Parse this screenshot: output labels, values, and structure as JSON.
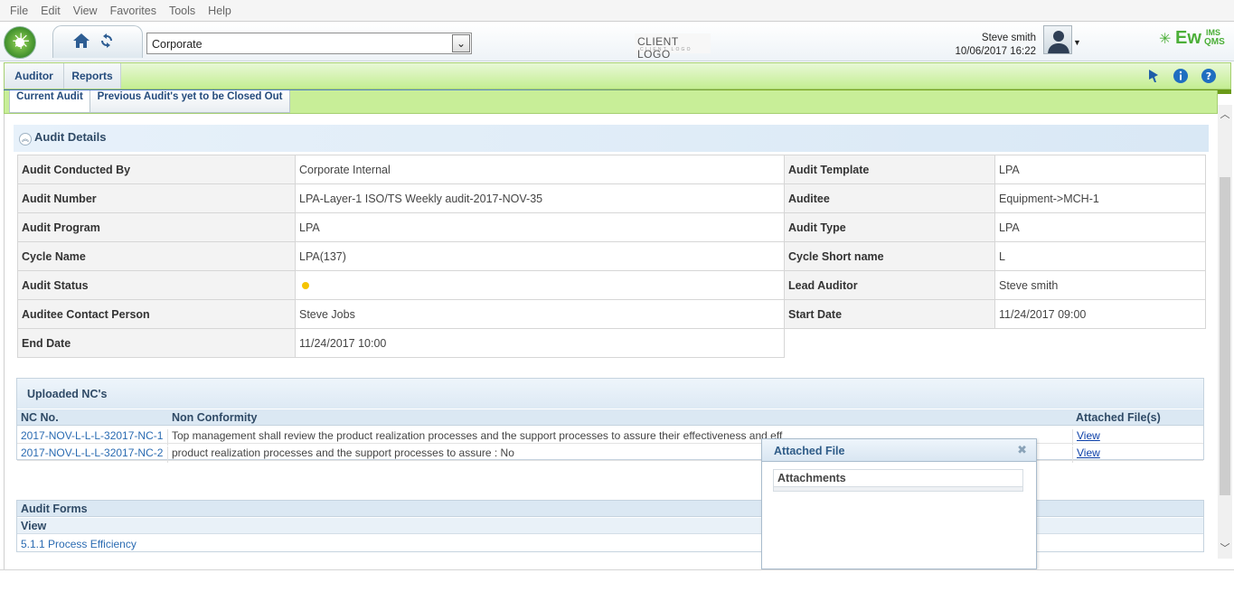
{
  "menu": [
    "File",
    "Edit",
    "View",
    "Favorites",
    "Tools",
    "Help"
  ],
  "header": {
    "organization_selected": "Corporate",
    "client_logo_text": "CLIENT LOGO",
    "client_logo_sub": "CLIENT LOGO",
    "user_name": "Steve smith",
    "user_datetime": "10/06/2017 16:22",
    "brand_ew": "Ew",
    "brand_ims": "IMS",
    "brand_qms": "QMS"
  },
  "toolbar": {
    "tabs": [
      "Auditor",
      "Reports"
    ]
  },
  "subtabs": [
    "Current Audit",
    "Previous Audit's yet to be Closed Out"
  ],
  "audit_details": {
    "title": "Audit Details",
    "rows": [
      {
        "l1": "Audit Conducted By",
        "v1": "Corporate Internal",
        "l2": "Audit Template",
        "v2": "LPA"
      },
      {
        "l1": "Audit Number",
        "v1": "LPA-Layer-1 ISO/TS Weekly audit-2017-NOV-35",
        "l2": "Auditee",
        "v2": "Equipment->MCH-1"
      },
      {
        "l1": "Audit Program",
        "v1": "LPA",
        "l2": "Audit Type",
        "v2": "LPA"
      },
      {
        "l1": "Cycle Name",
        "v1": "LPA(137)",
        "l2": "Cycle Short name",
        "v2": "L"
      },
      {
        "l1": "Audit Status",
        "v1": "",
        "l2": "Lead Auditor",
        "v2": "Steve smith"
      },
      {
        "l1": "Auditee Contact Person",
        "v1": "Steve Jobs",
        "l2": "Start Date",
        "v2": "11/24/2017 09:00"
      },
      {
        "l1": "End Date",
        "v1": "11/24/2017 10:00",
        "l2": "",
        "v2": ""
      }
    ]
  },
  "uploaded_ncs": {
    "title": "Uploaded NC's",
    "columns": [
      "NC No.",
      "Non Conformity",
      "Attached File(s)"
    ],
    "rows": [
      {
        "nc_no": "2017-NOV-L-L-L-32017-NC-1",
        "text": "Top management shall review the product realization processes and the support processes to assure their effectiveness and eff",
        "file": "View"
      },
      {
        "nc_no": "2017-NOV-L-L-L-32017-NC-2",
        "text": "product realization processes and the support processes to assure : No",
        "file": "View"
      }
    ]
  },
  "audit_forms": {
    "title": "Audit Forms",
    "column": "View",
    "rows": [
      "5.1.1 Process Efficiency"
    ]
  },
  "popup": {
    "title": "Attached File",
    "section": "Attachments"
  },
  "colors": {
    "status_dot": "#f5c400",
    "link": "#2a6bb2",
    "brand_green": "#4caf38",
    "toolbar_green": "#c4ee92"
  }
}
